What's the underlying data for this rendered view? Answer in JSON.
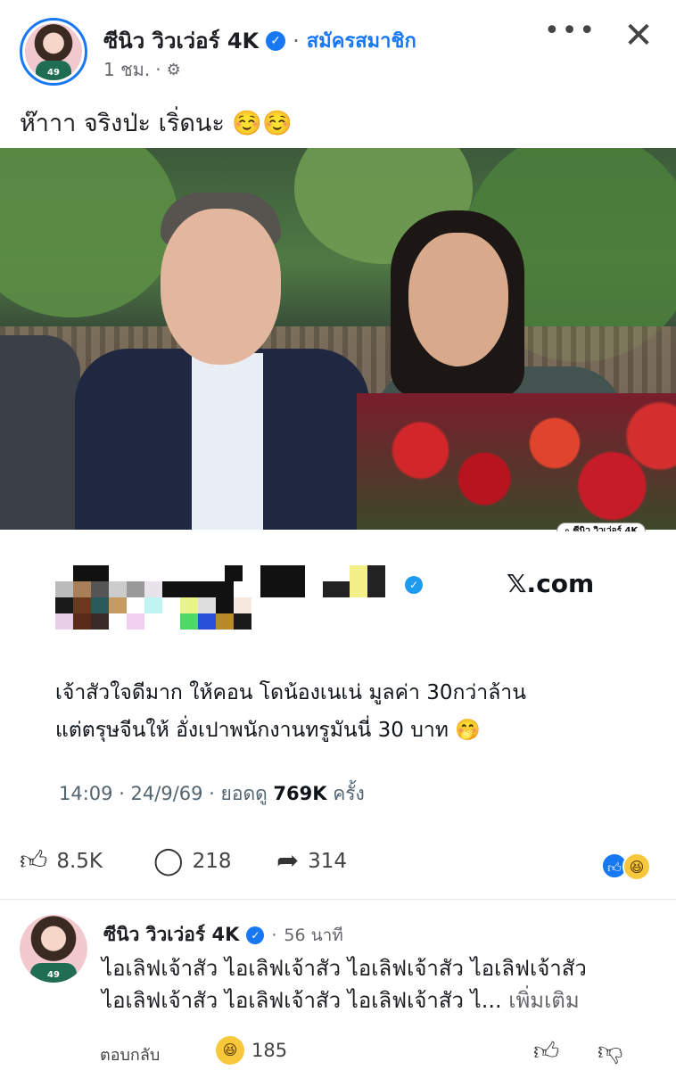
{
  "header": {
    "author_name": "ซีนิว วิวเว่อร์ 4K",
    "subscribe_label": "สมัครสมาชิก",
    "time_ago": "1 ชม.",
    "more_label": "•••",
    "close_label": "✕",
    "avatar_number": "49"
  },
  "post": {
    "caption": "ห๊าาา จริงป่ะ เริ่ดนะ ☺️☺️",
    "watermark": "ซีนิว วิวเว่อร์ 4K"
  },
  "embed_card": {
    "domain": "𝕏.com",
    "text_line1": "เจ้าสัวใจดีมาก ให้คอน โดน้องเนเน่ มูลค่า 30กว่าล้าน",
    "text_line2": "แต่ตรุษจีนให้ อั่งเปาพนักงานทรูมันนี่ 30 บาท 🤭",
    "meta_prefix": "14:09 · 24/9/69 · ยอดดู ",
    "views": "769K",
    "meta_suffix": " ครั้ง"
  },
  "actions": {
    "likes": "8.5K",
    "comments": "218",
    "shares": "314"
  },
  "comment": {
    "author_name": "ซีนิว วิวเว่อร์ 4K",
    "time_ago": "56 นาที",
    "text_line1": "ไอเลิฟเจ้าสัว ไอเลิฟเจ้าสัว ไอเลิฟเจ้าสัว ไอเลิฟเจ้าสัว",
    "text_line2": "ไอเลิฟเจ้าสัว ไอเลิฟเจ้าสัว ไอเลิฟเจ้าสัว ไ...",
    "see_more": "เพิ่มเติม",
    "reply_label": "ตอบกลับ",
    "reaction_count": "185",
    "avatar_number": "49"
  },
  "colors": {
    "accent": "#1877f2",
    "x_verified": "#1d9bf0",
    "text_primary": "#1c1e21",
    "text_secondary": "#65676b"
  },
  "icons": {
    "verified": "verified-badge-icon",
    "settings": "gear-icon",
    "like": "thumbs-up-icon",
    "comment": "speech-bubble-icon",
    "share": "share-arrow-icon",
    "haha": "laughing-face-icon",
    "dislike": "thumbs-down-icon"
  }
}
